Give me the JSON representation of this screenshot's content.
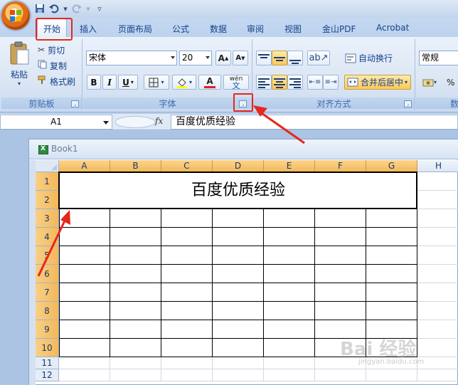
{
  "title_bar": {
    "quick_access": [
      "save-icon",
      "undo-icon",
      "redo-icon",
      "customize-icon"
    ]
  },
  "tabs": [
    {
      "label": "开始",
      "active": true
    },
    {
      "label": "插入"
    },
    {
      "label": "页面布局"
    },
    {
      "label": "公式"
    },
    {
      "label": "数据"
    },
    {
      "label": "审阅"
    },
    {
      "label": "视图"
    },
    {
      "label": "金山PDF"
    },
    {
      "label": "Acrobat"
    }
  ],
  "ribbon": {
    "clipboard": {
      "paste_label": "粘贴",
      "cut_label": "剪切",
      "copy_label": "复制",
      "format_painter_label": "格式刷",
      "group_label": "剪贴板"
    },
    "font": {
      "font_name": "宋体",
      "font_size": "20",
      "bold": "B",
      "italic": "I",
      "underline": "U",
      "phonetic": "wén",
      "phonetic_char": "文",
      "grow": "A",
      "shrink": "A",
      "color_a": "A",
      "group_label": "字体"
    },
    "alignment": {
      "wrap_label": "自动换行",
      "merge_label": "合并后居中",
      "group_label": "对齐方式"
    },
    "number": {
      "format": "常规",
      "percent": "%",
      "group_label": "数"
    }
  },
  "formula_bar": {
    "name_box": "A1",
    "fx_label": "fx",
    "content": "百度优质经验"
  },
  "workbook": {
    "title": "Book1",
    "columns": [
      "A",
      "B",
      "C",
      "D",
      "E",
      "F",
      "G",
      "H"
    ],
    "rows": [
      "1",
      "2",
      "3",
      "4",
      "5",
      "6",
      "7",
      "8",
      "9",
      "10",
      "11",
      "12"
    ],
    "merged_text": "百度优质经验"
  },
  "watermark": {
    "text": "Bai  经验",
    "sub": "jingyan.baidu.com"
  },
  "colors": {
    "accent": "#15428b",
    "highlight": "#e8261c",
    "selected_header": "#f3b85a"
  }
}
